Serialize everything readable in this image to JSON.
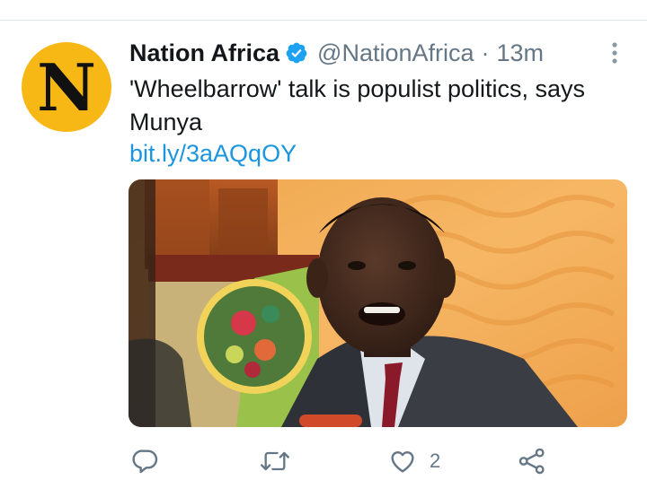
{
  "tweet": {
    "display_name": "Nation Africa",
    "handle": "@NationAfrica",
    "separator": "·",
    "time": "13m",
    "text": "'Wheelbarrow' talk is populist politics, says Munya",
    "link": "bit.ly/3aAQqOY",
    "verified": true
  },
  "avatar": {
    "letter": "N",
    "background": "#f7b815"
  },
  "actions": {
    "reply_count": "",
    "retweet_count": "",
    "like_count": "2",
    "share_count": ""
  },
  "colors": {
    "link": "#1b95e0",
    "muted": "#657786",
    "verified": "#1da1f2"
  },
  "icons": {
    "verified": "verified-icon",
    "more": "more-vertical-icon",
    "reply": "reply-icon",
    "retweet": "retweet-icon",
    "like": "heart-icon",
    "share": "share-icon"
  }
}
